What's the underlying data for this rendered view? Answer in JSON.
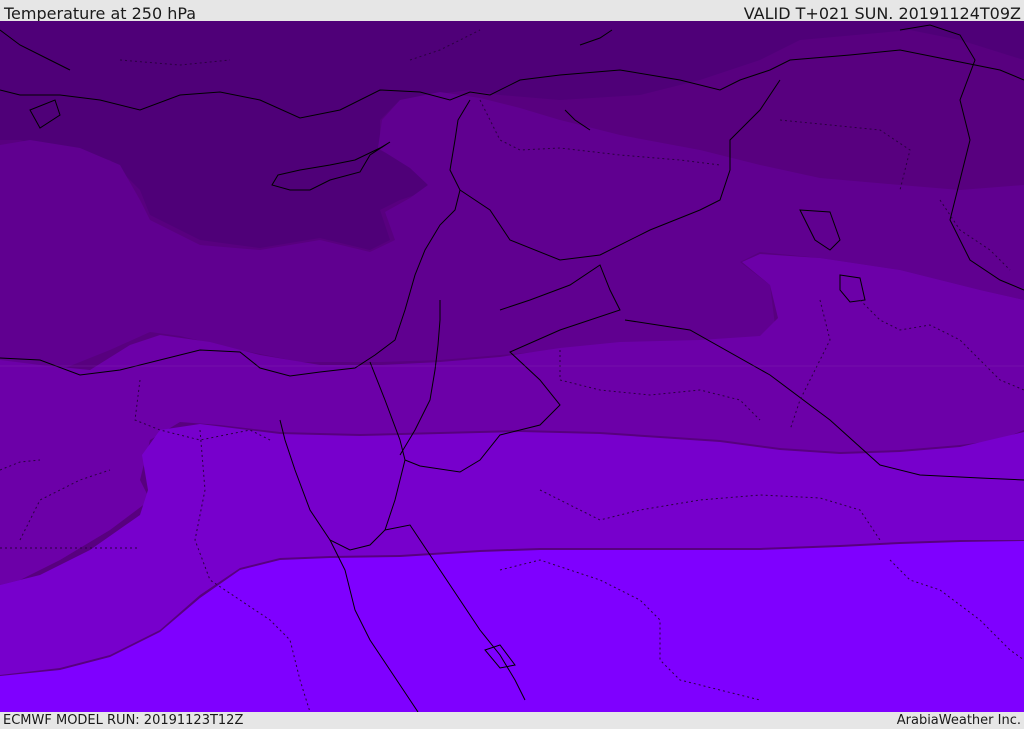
{
  "header": {
    "title": "Temperature at 250 hPa",
    "valid": "VALID T+021 SUN. 20191124T09Z"
  },
  "footer": {
    "model_run": "ECMWF MODEL RUN: 20191123T12Z",
    "credit": "ArabiaWeather Inc."
  },
  "colors": {
    "band_1": "#55007f",
    "band_2": "#600090",
    "band_3": "#6c00a8",
    "band_4": "#7000c0",
    "band_5": "#7a00dc",
    "band_6": "#7f00ff",
    "boundary": "#000000",
    "chrome": "#e6e6e6"
  }
}
